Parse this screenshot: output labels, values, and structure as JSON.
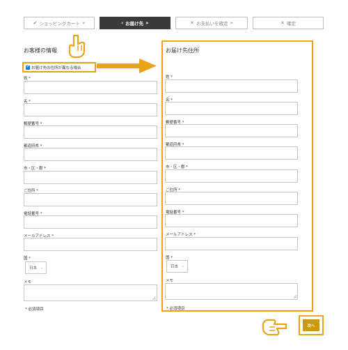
{
  "steps": [
    {
      "label": "ショッピングカート",
      "prefix": "✔",
      "suffix": "»"
    },
    {
      "label": "お届け先",
      "prefix": "›",
      "suffix": "»"
    },
    {
      "label": "お支払いを確定",
      "prefix": "✕",
      "suffix": "»"
    },
    {
      "label": "確定",
      "prefix": "✕",
      "suffix": ""
    }
  ],
  "billing": {
    "heading": "お客様の情報",
    "different_address_checkbox": {
      "label": "お届け先の住所が異なる場合",
      "checked": true,
      "check_glyph": "✔"
    },
    "fields": {
      "last_name": "姓 *",
      "first_name": "名 *",
      "postcode": "郵便番号 *",
      "prefecture": "都道府県 *",
      "city": "市・区・郡 *",
      "address": "ご住所 *",
      "phone": "電話番号 *",
      "email": "メールアドレス *",
      "country": "国 *",
      "memo": "メモ"
    },
    "country_value": "日本",
    "required_note": "* 必須項目"
  },
  "shipping": {
    "heading": "お届け先住所",
    "fields": {
      "last_name": "姓 *",
      "first_name": "名 *",
      "postcode": "郵便番号 *",
      "prefecture": "都道府県 *",
      "city": "市・区・郡 *",
      "address": "ご住所 *",
      "phone": "電話番号 *",
      "email": "メールアドレス *",
      "country": "国 *",
      "memo": "メモ"
    },
    "country_value": "日本",
    "required_note": "* 必須項目"
  },
  "next_button": {
    "label": "次へ"
  },
  "select_chevron": "⌄",
  "annotations": {
    "highlight_color": "#e8a317",
    "icons": [
      "pointing-hand-down-icon",
      "pointing-hand-right-icon",
      "arrow-right-icon"
    ]
  }
}
